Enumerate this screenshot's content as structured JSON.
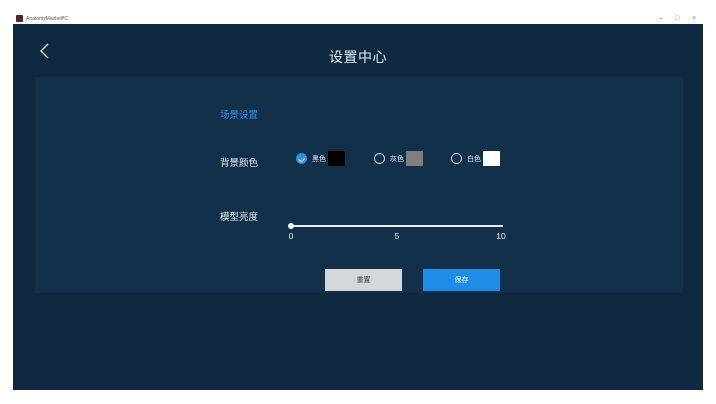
{
  "window": {
    "title": "AnatomyMasterPC",
    "minimize_glyph": "–",
    "maximize_glyph": "□",
    "close_glyph": "×"
  },
  "header": {
    "back_icon": "chevron-left-icon",
    "title": "设置中心"
  },
  "scene": {
    "section_title": "场景设置",
    "background": {
      "label": "背景颜色",
      "options": [
        {
          "label": "黑色",
          "color": "#000000",
          "checked": true
        },
        {
          "label": "灰色",
          "color": "#7f7f7f",
          "checked": false
        },
        {
          "label": "白色",
          "color": "#ffffff",
          "checked": false
        }
      ]
    },
    "brightness": {
      "label": "模型亮度",
      "min": 0,
      "max": 10,
      "value": 0,
      "ticks": [
        "0",
        "5",
        "10"
      ]
    }
  },
  "actions": {
    "reset_label": "重置",
    "save_label": "保存"
  },
  "colors": {
    "background": "#0f2a40",
    "panel": "#12304a",
    "accent": "#1f8ce6",
    "section_title": "#2f93e8"
  }
}
